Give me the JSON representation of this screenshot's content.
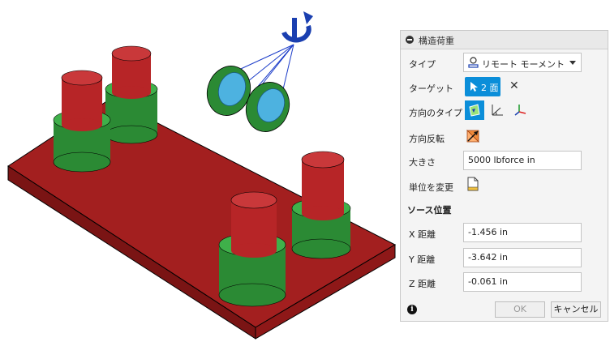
{
  "panel": {
    "title": "構造荷重",
    "type_label": "タイプ",
    "type_value": "リモート モーメント",
    "target_label": "ターゲット",
    "target_value": "2 面",
    "direction_type_label": "方向のタイプ",
    "flip_direction_label": "方向反転",
    "magnitude_label": "大きさ",
    "magnitude_value": "5000 lbforce in",
    "change_units_label": "単位を変更",
    "source_position_label": "ソース位置",
    "x_label": "X 距離",
    "x_value": "-1.456 in",
    "y_label": "Y 距離",
    "y_value": "-3.642 in",
    "z_label": "Z 距離",
    "z_value": "-0.061 in",
    "ok_label": "OK",
    "cancel_label": "キャンセル",
    "info_glyph": "i"
  },
  "colors": {
    "plate": "#b22222",
    "cylinder_red": "#c0282c",
    "cylinder_green": "#2f9a3a",
    "accent": "#0b8ed9",
    "moment_icon": "#1a3fb0"
  }
}
